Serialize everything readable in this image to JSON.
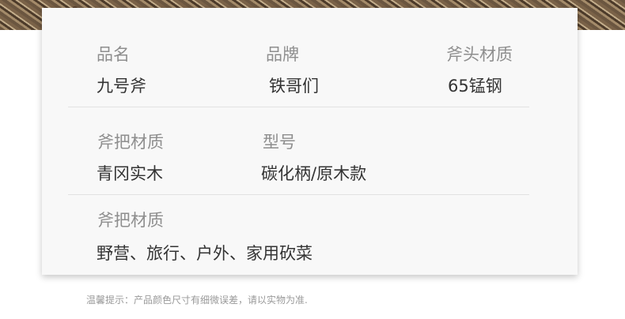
{
  "specs": {
    "row1": [
      {
        "label": "品名",
        "value": "九号斧"
      },
      {
        "label": "品牌",
        "value": "铁哥们"
      },
      {
        "label": "斧头材质",
        "value": "65锰钢"
      }
    ],
    "row2": [
      {
        "label": "斧把材质",
        "value": "青冈实木"
      },
      {
        "label": "型号",
        "value": "碳化柄/原木款"
      }
    ],
    "row3": [
      {
        "label": "斧把材质",
        "value": "野营、旅行、户外、家用砍菜"
      }
    ]
  },
  "footnote": "温馨提示：产品颜色尺寸有细微误差，请以实物为准."
}
